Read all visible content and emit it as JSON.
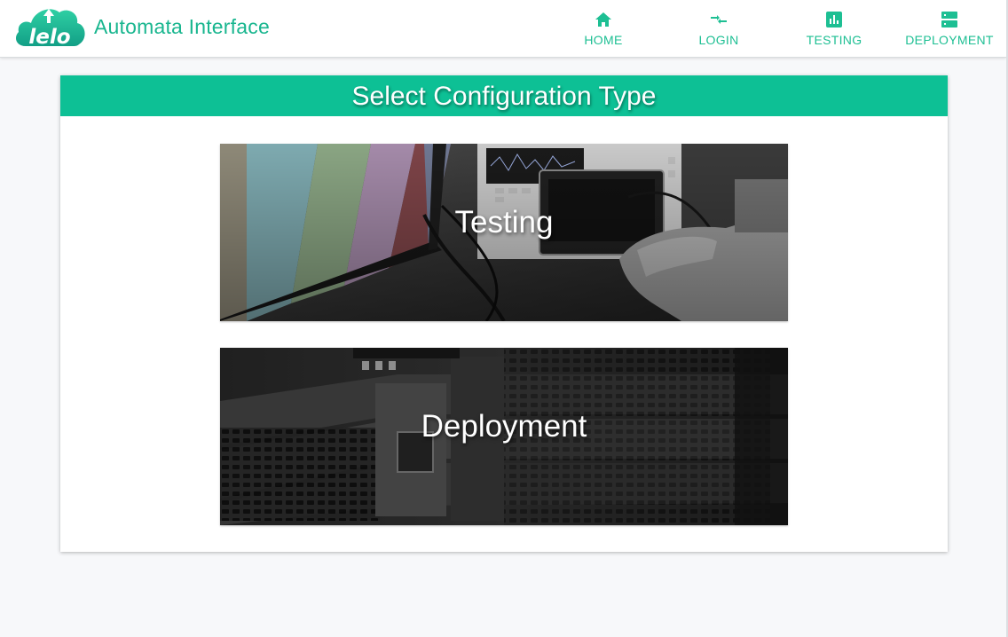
{
  "colors": {
    "accent": "#0dc095",
    "nav_text": "#1dbf93",
    "background": "#f7f8fa"
  },
  "navbar": {
    "logo_text": "lelo",
    "app_title": "Automata Interface",
    "items": [
      {
        "label": "HOME",
        "icon": "home-icon"
      },
      {
        "label": "LOGIN",
        "icon": "login-arrows-icon"
      },
      {
        "label": "TESTING",
        "icon": "bar-chart-icon"
      },
      {
        "label": "DEPLOYMENT",
        "icon": "server-icon"
      }
    ]
  },
  "main": {
    "heading": "Select Configuration Type",
    "options": [
      {
        "label": "Testing",
        "image": "electronics-test-equipment-photo"
      },
      {
        "label": "Deployment",
        "image": "server-rack-photo"
      }
    ]
  }
}
